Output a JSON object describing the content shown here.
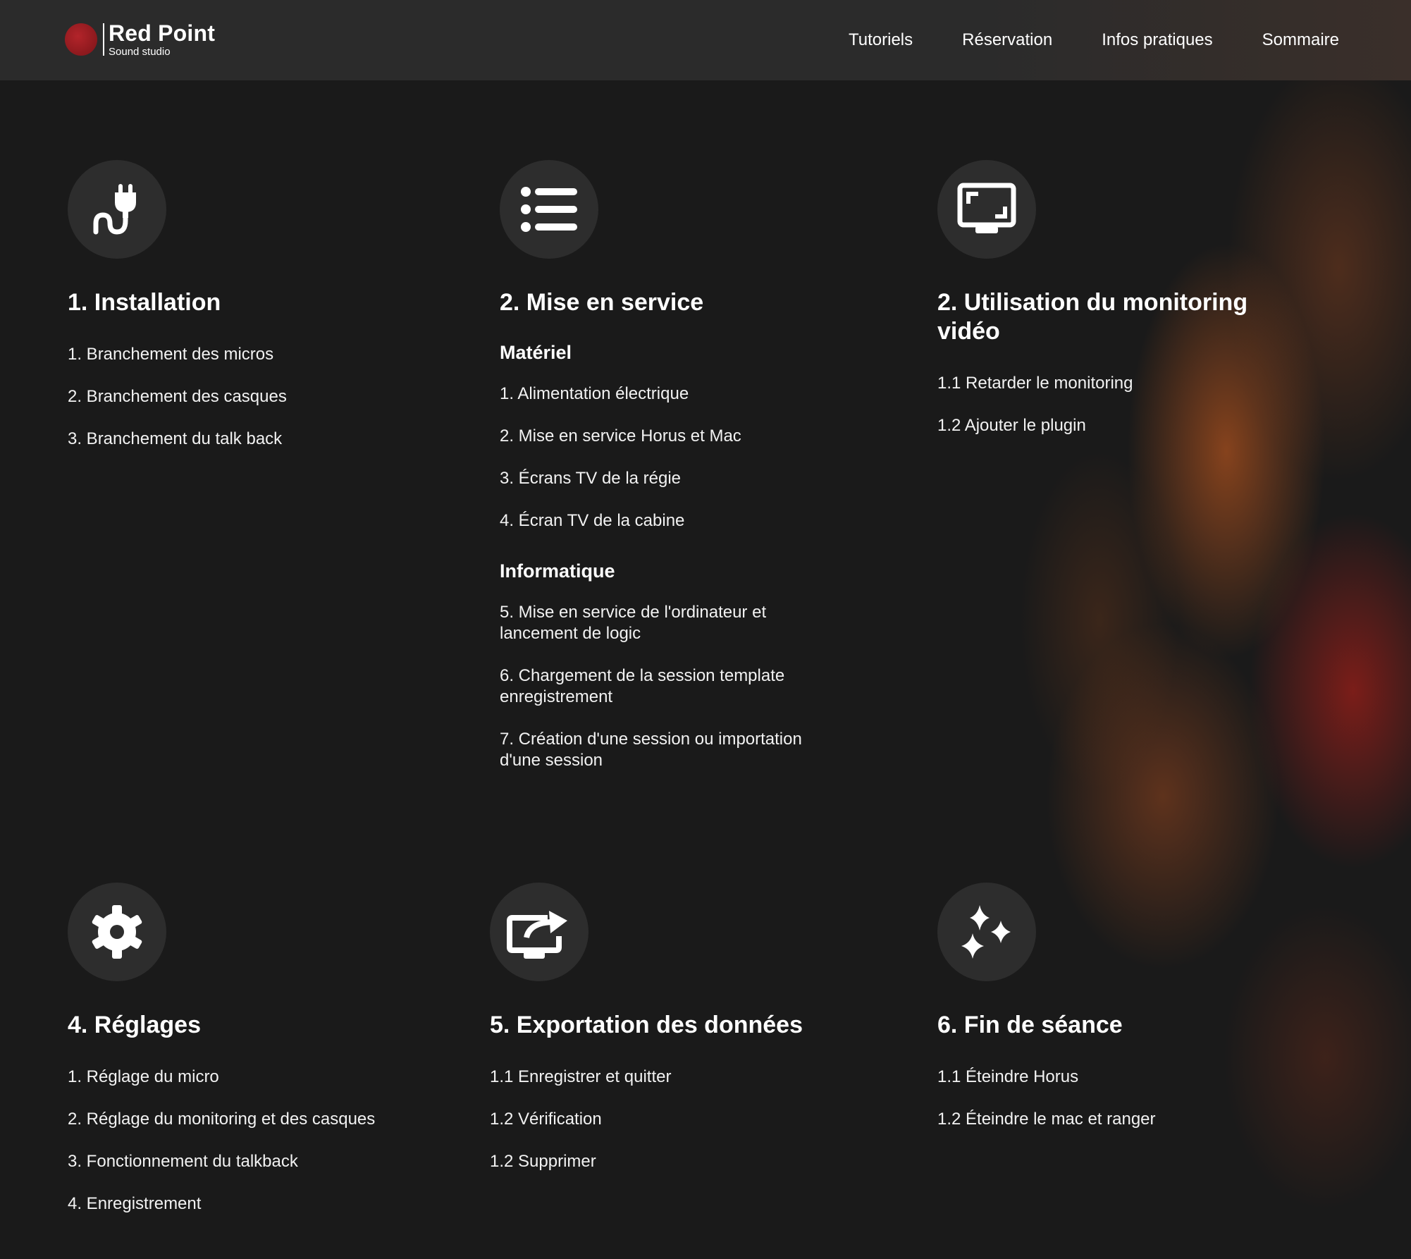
{
  "header": {
    "logo_title": "Red Point",
    "logo_subtitle": "Sound studio",
    "nav": [
      "Tutoriels",
      "Réservation",
      "Infos pratiques",
      "Sommaire"
    ]
  },
  "colors": {
    "background": "#1a1a1a",
    "header_bg": "#2b2b2b",
    "icon_circle": "#2d2d2d",
    "brand_red": "#9b1c22",
    "text": "#ffffff"
  },
  "sections": [
    {
      "icon": "plug-icon",
      "title": "1. Installation",
      "items": [
        "1. Branchement des micros",
        "2. Branchement des casques",
        "3. Branchement du talk back"
      ]
    },
    {
      "icon": "list-icon",
      "title": "2. Mise en service",
      "groups": [
        {
          "heading": "Matériel",
          "items": [
            "1. Alimentation électrique",
            "2. Mise en service Horus et Mac",
            "3. Écrans TV de la régie",
            "4. Écran TV de la cabine"
          ]
        },
        {
          "heading": "Informatique",
          "items": [
            "5. Mise en service de l'ordinateur et lancement de logic",
            "6. Chargement de la session template enregistrement",
            "7. Création d'une session ou importation d'une session"
          ]
        }
      ]
    },
    {
      "icon": "monitor-icon",
      "title": "2. Utilisation du monitoring vidéo",
      "items": [
        "1.1 Retarder le monitoring",
        "1.2 Ajouter le plugin"
      ]
    },
    {
      "icon": "gear-icon",
      "title": "4. Réglages",
      "items": [
        "1. Réglage du micro",
        "2. Réglage du monitoring et des casques",
        "3. Fonctionnement du talkback",
        "4. Enregistrement"
      ]
    },
    {
      "icon": "export-icon",
      "title": "5. Exportation des données",
      "items": [
        "1.1 Enregistrer et quitter",
        "1.2 Vérification",
        "1.2 Supprimer"
      ]
    },
    {
      "icon": "sparkles-icon",
      "title": "6. Fin de séance",
      "items": [
        "1.1 Éteindre Horus",
        "1.2 Éteindre le mac et ranger"
      ]
    }
  ]
}
